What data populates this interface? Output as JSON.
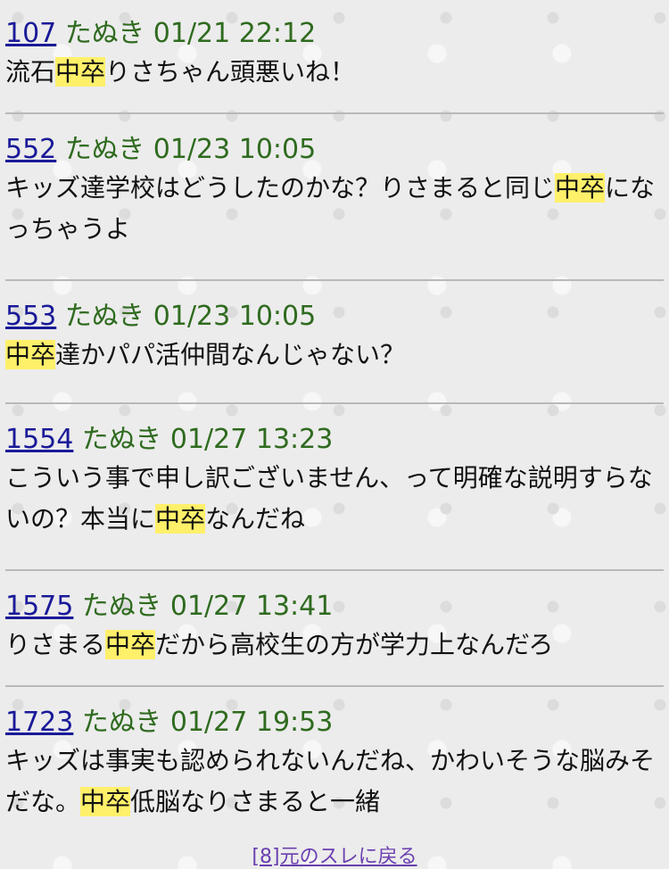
{
  "posts": [
    {
      "num": "107",
      "name": "たぬき",
      "date": "01/21 22:12",
      "body": [
        [
          "流石",
          false
        ],
        [
          "中卒",
          true
        ],
        [
          "りさちゃん頭悪いね！",
          false
        ]
      ]
    },
    {
      "num": "552",
      "name": "たぬき",
      "date": "01/23 10:05",
      "body": [
        [
          "キッズ達学校はどうしたのかな？りさまると同じ",
          false
        ],
        [
          "中卒",
          true
        ],
        [
          "になっちゃうよ",
          false
        ]
      ]
    },
    {
      "num": "553",
      "name": "たぬき",
      "date": "01/23 10:05",
      "body": [
        [
          "中卒",
          true
        ],
        [
          "達かパパ活仲間なんじゃない？",
          false
        ]
      ]
    },
    {
      "num": "1554",
      "name": "たぬき",
      "date": "01/27 13:23",
      "body": [
        [
          "こういう事で申し訳ございません、って明確な説明すらないの？本当に",
          false
        ],
        [
          "中卒",
          true
        ],
        [
          "なんだね",
          false
        ]
      ]
    },
    {
      "num": "1575",
      "name": "たぬき",
      "date": "01/27 13:41",
      "body": [
        [
          "りさまる",
          false
        ],
        [
          "中卒",
          true
        ],
        [
          "だから高校生の方が学力上なんだろ",
          false
        ]
      ]
    },
    {
      "num": "1723",
      "name": "たぬき",
      "date": "01/27 19:53",
      "body": [
        [
          "キッズは事実も認められないんだね、かわいそうな脳みそだな。",
          false
        ],
        [
          "中卒",
          true
        ],
        [
          "低脳なりさまると一緒",
          false
        ]
      ]
    }
  ],
  "footer": {
    "back_link": "[8]元のスレに戻る"
  }
}
